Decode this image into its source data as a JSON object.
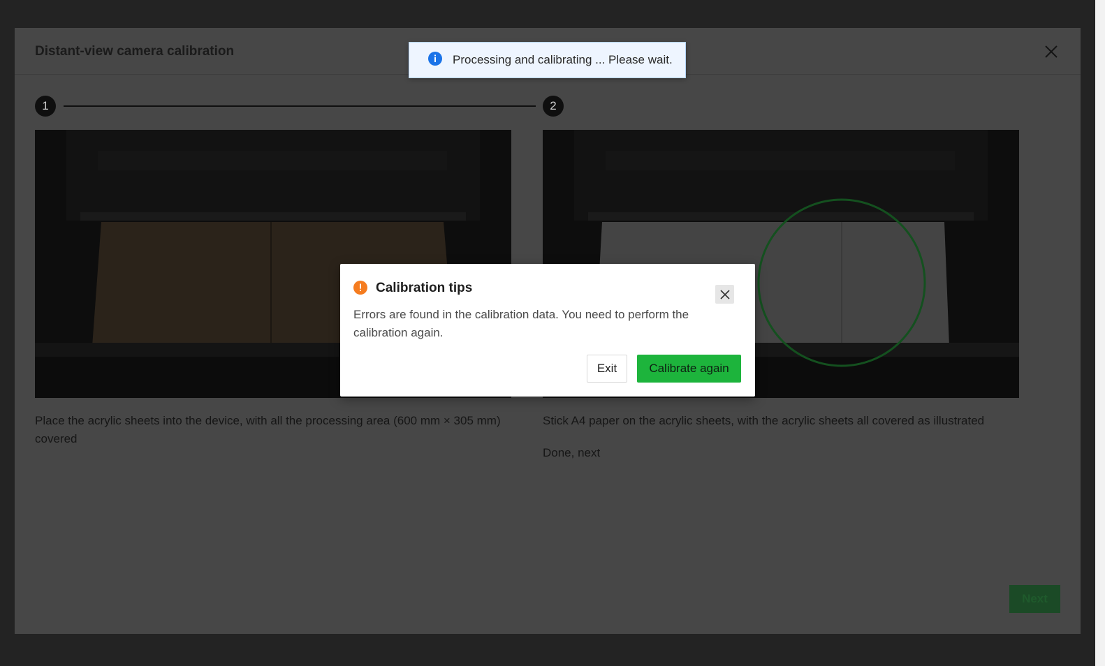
{
  "modal": {
    "title": "Distant-view camera calibration",
    "steps": [
      {
        "number": "1",
        "description": "Place the acrylic sheets into the device, with all the processing area (600 mm × 305 mm) covered"
      },
      {
        "number": "2",
        "description": "Stick A4 paper on the acrylic sheets, with the acrylic sheets all covered as illustrated",
        "status": "Done, next"
      }
    ],
    "next_label": "Next"
  },
  "toast": {
    "icon": "info-icon",
    "message": "Processing and calibrating ... Please wait."
  },
  "dialog": {
    "icon": "warning-icon",
    "title": "Calibration tips",
    "body": "Errors are found in the calibration data. You need to perform the calibration again.",
    "exit_label": "Exit",
    "again_label": "Calibrate again"
  },
  "colors": {
    "accent_green": "#1db43c",
    "info_blue": "#1a73e8",
    "warning_orange": "#f57c1f"
  }
}
